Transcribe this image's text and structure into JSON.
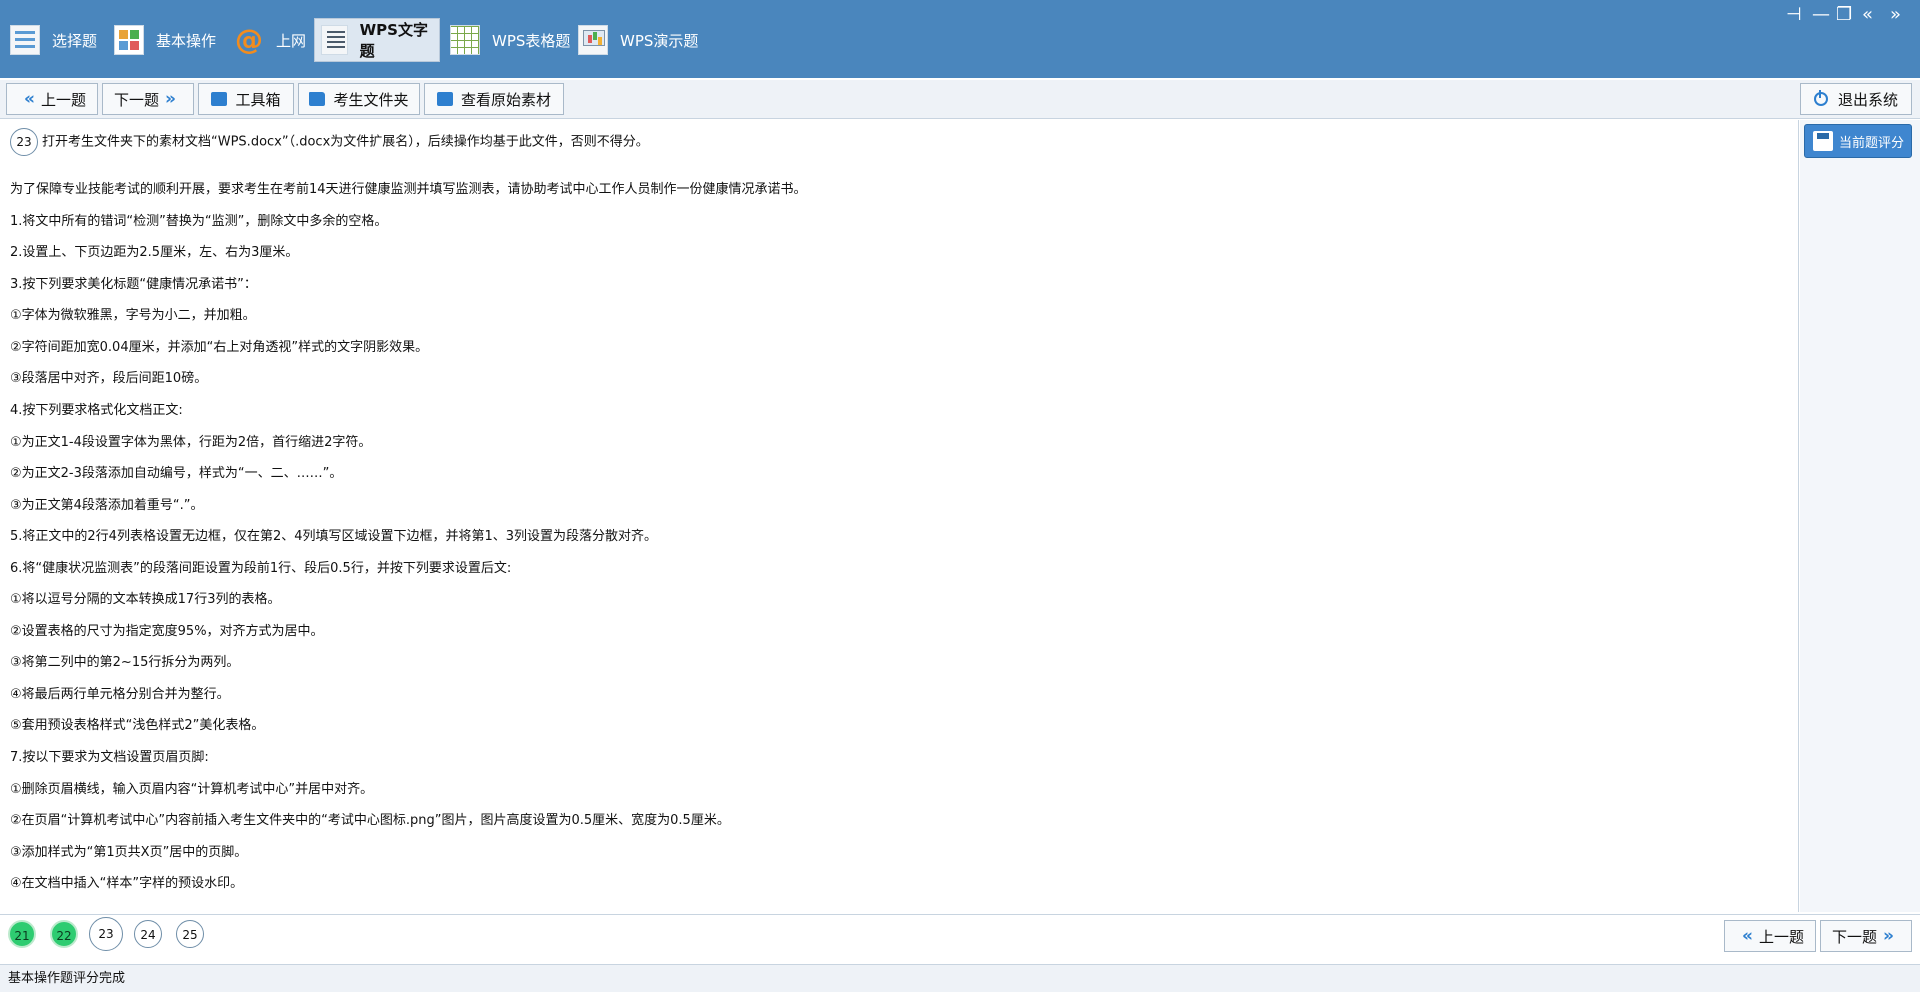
{
  "modules": [
    {
      "label": "选择题",
      "icon": "list-icon"
    },
    {
      "label": "基本操作",
      "icon": "grid-icon"
    },
    {
      "label": "上网",
      "icon": "at-icon"
    },
    {
      "label": "WPS文字题",
      "icon": "document-icon"
    },
    {
      "label": "WPS表格题",
      "icon": "spreadsheet-icon"
    },
    {
      "label": "WPS演示题",
      "icon": "presentation-icon"
    }
  ],
  "active_module": "WPS文字题",
  "toolbar": {
    "prev": "上一题",
    "next": "下一题",
    "toolbox": "工具箱",
    "student_folder": "考生文件夹",
    "view_source": "查看原始素材",
    "exit": "退出系统"
  },
  "score_button": "当前题评分",
  "question": {
    "number": "23",
    "lines": [
      "打开考生文件夹下的素材文档“WPS.docx”（.docx为文件扩展名），后续操作均基于此文件，否则不得分。",
      "为了保障专业技能考试的顺利开展，要求考生在考前14天进行健康监测并填写监测表，请协助考试中心工作人员制作一份健康情况承诺书。",
      "1.将文中所有的错词“检测”替换为“监测”，删除文中多余的空格。",
      "2.设置上、下页边距为2.5厘米，左、右为3厘米。",
      "3.按下列要求美化标题“健康情况承诺书”：",
      "①字体为微软雅黑，字号为小二，并加粗。",
      "②字符间距加宽0.04厘米，并添加“右上对角透视”样式的文字阴影效果。",
      "③段落居中对齐，段后间距10磅。",
      "4.按下列要求格式化文档正文:",
      "①为正文1-4段设置字体为黑体，行距为2倍，首行缩进2字符。",
      "②为正文2-3段落添加自动编号，样式为“一、二、……”。",
      "③为正文第4段落添加着重号“.”。",
      "5.将正文中的2行4列表格设置无边框，仅在第2、4列填写区域设置下边框，并将第1、3列设置为段落分散对齐。",
      "6.将“健康状况监测表”的段落间距设置为段前1行、段后0.5行，并按下列要求设置后文:",
      "①将以逗号分隔的文本转换成17行3列的表格。",
      "②设置表格的尺寸为指定宽度95%，对齐方式为居中。",
      "③将第二列中的第2~15行拆分为两列。",
      "④将最后两行单元格分别合并为整行。",
      "⑤套用预设表格样式“浅色样式2”美化表格。",
      "7.按以下要求为文档设置页眉页脚:",
      "①删除页眉横线，输入页眉内容“计算机考试中心”并居中对齐。",
      "②在页眉“计算机考试中心”内容前插入考生文件夹中的“考试中心图标.png”图片，图片高度设置为0.5厘米、宽度为0.5厘米。",
      "③添加样式为“第1页共X页”居中的页脚。",
      "④在文档中插入“样本”字样的预设水印。"
    ]
  },
  "pager": [
    {
      "n": "21",
      "state": "done"
    },
    {
      "n": "22",
      "state": "done"
    },
    {
      "n": "23",
      "state": "current"
    },
    {
      "n": "24",
      "state": "todo"
    },
    {
      "n": "25",
      "state": "todo"
    }
  ],
  "bottom_nav": {
    "prev": "上一题",
    "next": "下一题"
  },
  "status": "基本操作题评分完成",
  "colors": {
    "topbar": "#4a86bd",
    "done": "#2ecc71",
    "accent": "#2d7fcf"
  }
}
